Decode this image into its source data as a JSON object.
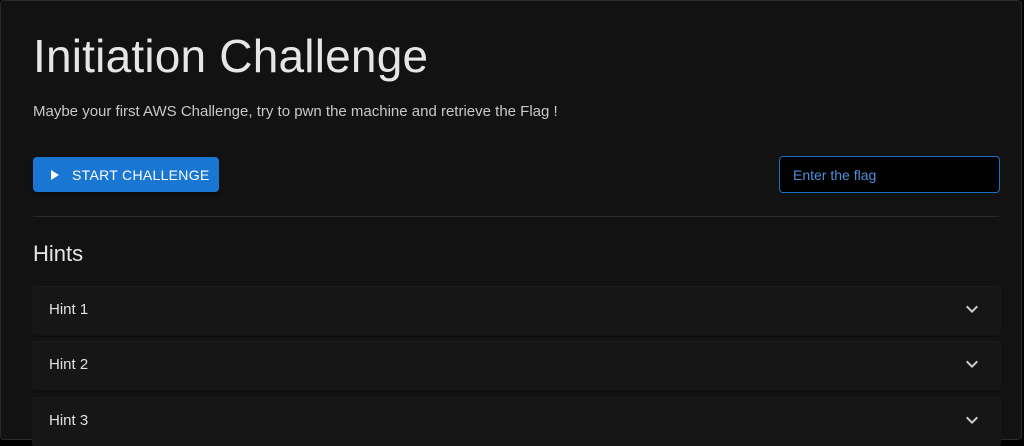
{
  "challenge": {
    "title": "Initiation Challenge",
    "description": "Maybe your first AWS Challenge, try to pwn the machine and retrieve the Flag !"
  },
  "actions": {
    "start_label": "START CHALLENGE",
    "start_icon": "play-icon",
    "flag_placeholder": "Enter the flag",
    "flag_value": ""
  },
  "hints": {
    "heading": "Hints",
    "items": [
      {
        "label": "Hint 1",
        "icon": "chevron-down-icon"
      },
      {
        "label": "Hint 2",
        "icon": "chevron-down-icon"
      },
      {
        "label": "Hint 3",
        "icon": "chevron-down-icon"
      }
    ]
  },
  "colors": {
    "background": "#121212",
    "accent": "#1976d2",
    "input_border": "#1e6fc4",
    "text": "#e6e6e6"
  }
}
